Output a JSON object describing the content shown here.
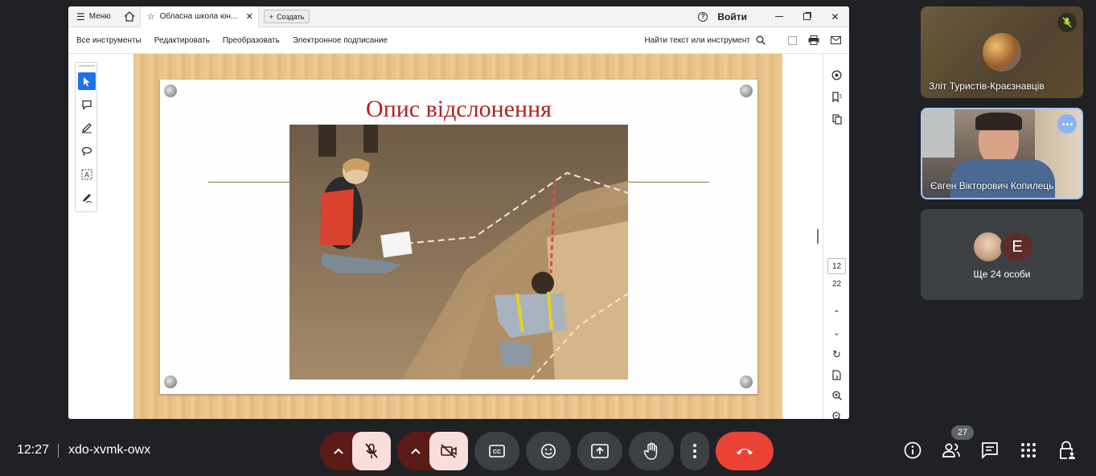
{
  "share_window": {
    "titlebar": {
      "menu_label": "Меню",
      "tab_title": "Обласна школа юн...",
      "new_button": "Создать",
      "login": "Войти"
    },
    "toolbar": {
      "items": [
        "Все инструменты",
        "Редактировать",
        "Преобразовать",
        "Электронное подписание"
      ],
      "search": "Найти текст или инструмент"
    },
    "slide": {
      "title": "Опис відслонення"
    },
    "page_nav": {
      "current": "12",
      "total": "22"
    }
  },
  "participants": [
    {
      "name": "Зліт Туристів-Краєзнавців",
      "mic": "muted"
    },
    {
      "name": "Євген Вікторович Копилець",
      "mic": "speaking"
    },
    {
      "name": "Ще 24 особи",
      "avatar_letter": "E"
    }
  ],
  "meeting": {
    "time": "12:27",
    "code": "xdo-xvmk-owx",
    "people_count": "27"
  },
  "colors": {
    "end_call": "#ea4335",
    "muted_button": "#f9dedc",
    "muted_arrow": "#5c1a17",
    "background": "#202124",
    "accent": "#1a73e8"
  }
}
